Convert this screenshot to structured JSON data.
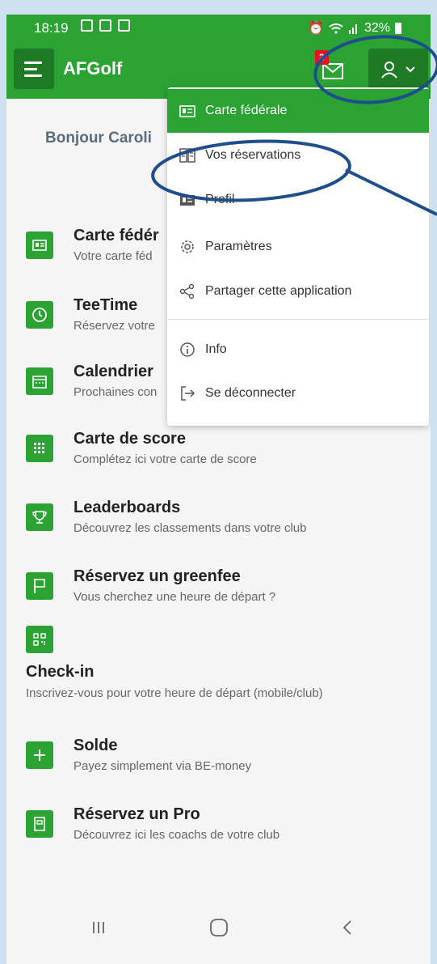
{
  "status": {
    "time": "18:19",
    "battery": "32%"
  },
  "app": {
    "title": "AFGolf",
    "mail_badge": "3"
  },
  "greeting": "Bonjour Caroli",
  "menu": {
    "items": [
      {
        "label": "Carte fédérale",
        "icon": "id-card-icon"
      },
      {
        "label": "Vos réservations",
        "icon": "reservations-icon"
      },
      {
        "label": "Profil",
        "icon": "profile-card-icon"
      },
      {
        "label": "Paramètres",
        "icon": "gear-icon"
      },
      {
        "label": "Partager cette application",
        "icon": "share-icon"
      },
      {
        "label": "Info",
        "icon": "info-icon"
      },
      {
        "label": "Se déconnecter",
        "icon": "logout-icon"
      }
    ]
  },
  "main": {
    "items": [
      {
        "title": "Carte fédér",
        "subtitle": "Votre carte féd",
        "icon": "id-card-icon"
      },
      {
        "title": "TeeTime",
        "subtitle": "Réservez votre",
        "icon": "clock-icon"
      },
      {
        "title": "Calendrier",
        "subtitle": "Prochaines con",
        "icon": "calendar-icon"
      },
      {
        "title": "Carte de score",
        "subtitle": "Complétez ici votre carte de score",
        "icon": "grid-icon"
      },
      {
        "title": "Leaderboards",
        "subtitle": "Découvrez les classements dans votre club",
        "icon": "trophy-icon"
      },
      {
        "title": "Réservez un greenfee",
        "subtitle": "Vous cherchez une heure de départ ?",
        "icon": "flag-icon"
      },
      {
        "title": "Check-in",
        "subtitle": "Inscrivez-vous pour votre heure de départ (mobile/club)",
        "icon": "qr-icon"
      },
      {
        "title": "Solde",
        "subtitle": "Payez simplement via BE-money",
        "icon": "plus-icon"
      },
      {
        "title": "Réservez un Pro",
        "subtitle": "Découvrez ici les coachs de votre club",
        "icon": "book-icon"
      }
    ]
  },
  "colors": {
    "brand_green": "#2aa333",
    "dark_green": "#1f7a26",
    "annotation": "#1f4e8c",
    "badge_red": "#e81123"
  }
}
